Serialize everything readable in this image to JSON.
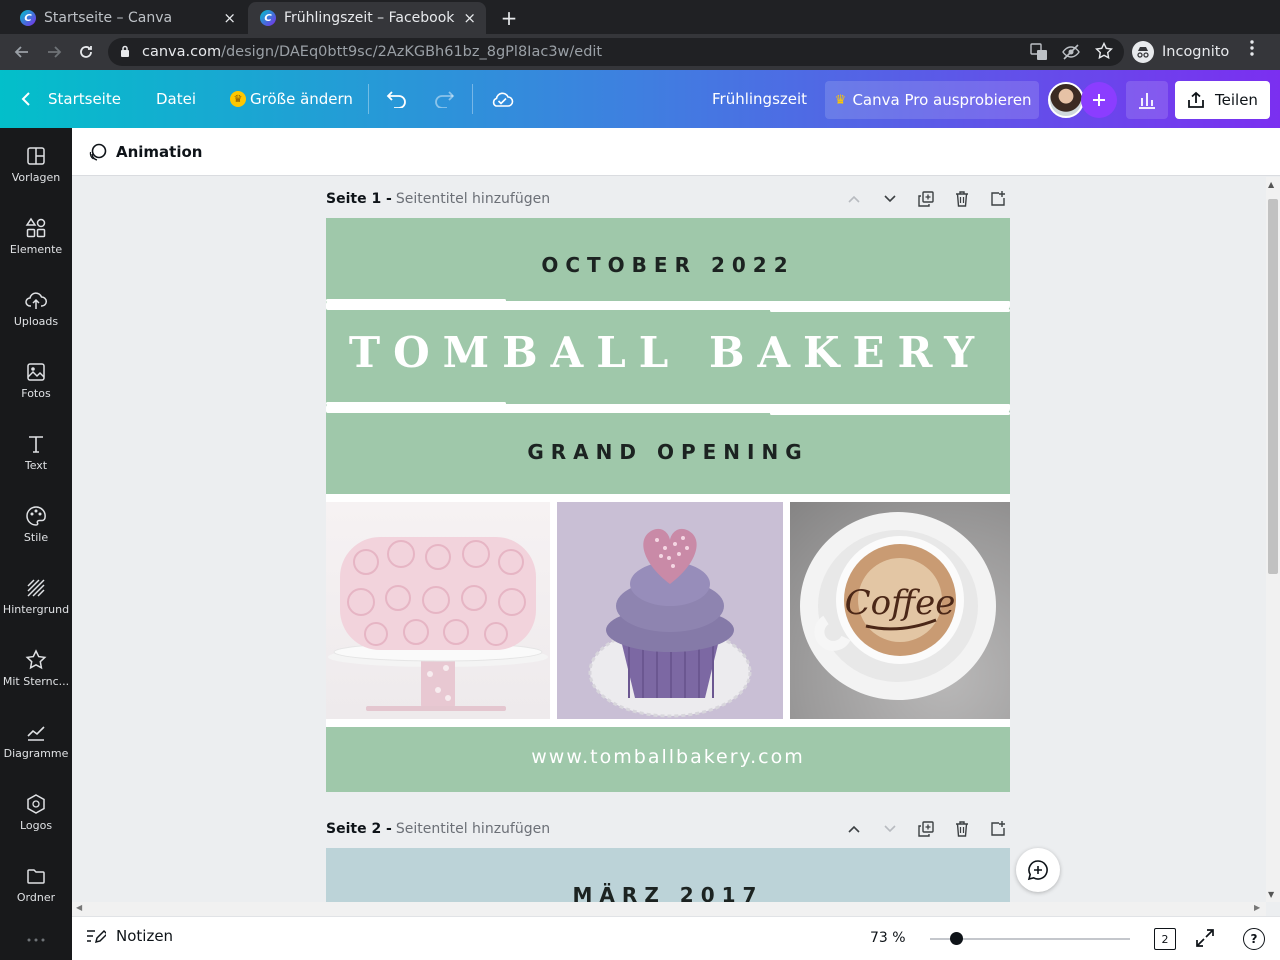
{
  "browser": {
    "tabs": [
      {
        "title": "Startseite – Canva",
        "favicon": "C"
      },
      {
        "title": "Frühlingszeit – Facebook-B",
        "favicon": "C"
      }
    ],
    "close_glyph": "×",
    "new_tab_glyph": "+",
    "url_host": "canva.com",
    "url_path": "/design/DAEq0btt9sc/2AzKGBh61bz_8gPl8Iac3w/edit",
    "incognito_label": "Incognito"
  },
  "topbar": {
    "home_label": "Startseite",
    "file_label": "Datei",
    "resize_label": "Größe ändern",
    "design_title": "Frühlingszeit",
    "pro_label": "Canva Pro ausprobieren",
    "share_label": "Teilen"
  },
  "sidebar": {
    "items": [
      {
        "label": "Vorlagen",
        "icon": "templates-icon"
      },
      {
        "label": "Elemente",
        "icon": "elements-icon"
      },
      {
        "label": "Uploads",
        "icon": "upload-cloud-icon"
      },
      {
        "label": "Fotos",
        "icon": "photos-icon"
      },
      {
        "label": "Text",
        "icon": "text-icon"
      },
      {
        "label": "Stile",
        "icon": "palette-icon"
      },
      {
        "label": "Hintergrund",
        "icon": "background-icon"
      },
      {
        "label": "Mit Sternc...",
        "icon": "star-icon"
      },
      {
        "label": "Diagramme",
        "icon": "chart-icon"
      },
      {
        "label": "Logos",
        "icon": "logo-icon"
      },
      {
        "label": "Ordner",
        "icon": "folder-icon"
      }
    ]
  },
  "editor": {
    "animation_label": "Animation",
    "pages": [
      {
        "number_label": "Seite 1 -",
        "title_placeholder": "Seitentitel hinzufügen"
      },
      {
        "number_label": "Seite 2 -",
        "title_placeholder": "Seitentitel hinzufügen"
      }
    ]
  },
  "design_page1": {
    "date": "OCTOBER 2022",
    "name": "TOMBALL BAKERY",
    "subtitle": "GRAND OPENING",
    "url": "www.tomballbakery.com",
    "background_color": "#9fc8aa"
  },
  "design_page2": {
    "date": "MÄRZ 2017",
    "background_color": "#bcd3d8"
  },
  "bottombar": {
    "notes_label": "Notizen",
    "zoom": "73 %",
    "page_count": "2",
    "help_glyph": "?"
  },
  "colors": {
    "brand_gradient_start": "#03bfca",
    "brand_gradient_end": "#7b2ff0",
    "sidebar_bg": "#18191b"
  }
}
